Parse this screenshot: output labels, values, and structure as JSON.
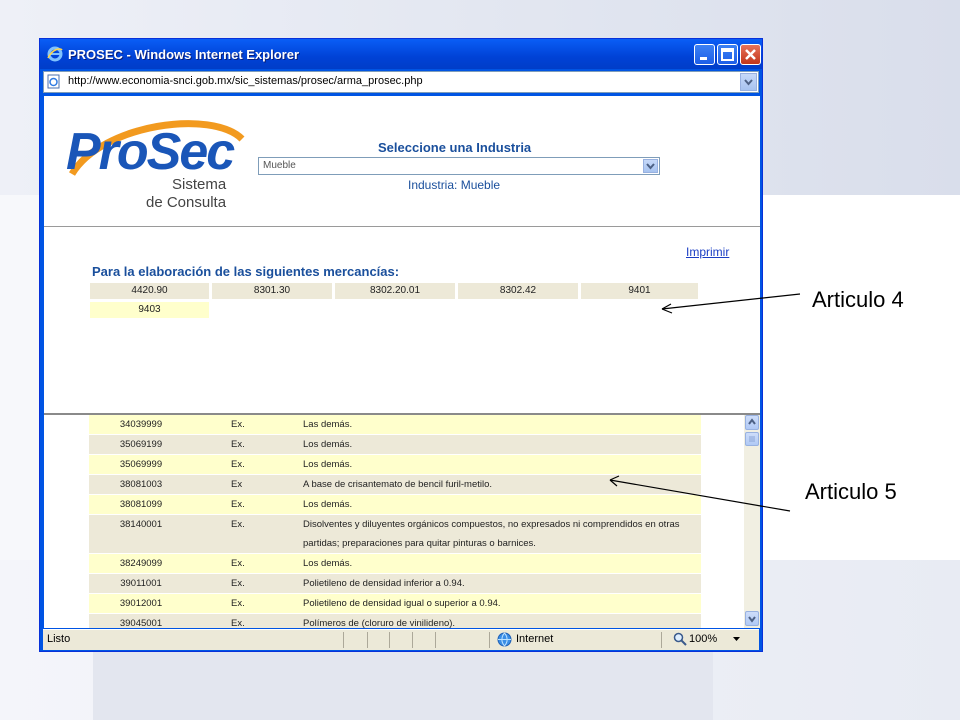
{
  "window": {
    "title": "PROSEC - Windows Internet Explorer"
  },
  "address": {
    "url": "http://www.economia-snci.gob.mx/sic_sistemas/prosec/arma_prosec.php"
  },
  "logo": {
    "name": "ProSec",
    "line1": "Sistema",
    "line2": "de Consulta"
  },
  "header": {
    "select_title": "Seleccione una Industria",
    "select_value": "Mueble",
    "industry_label": "Industria: Mueble"
  },
  "print_link": "Imprimir",
  "merchandise": {
    "title": "Para la elaboración de las siguientes mercancías:",
    "codes": [
      "4420.90",
      "8301.30",
      "8302.20.01",
      "8302.42",
      "9401",
      "9403"
    ]
  },
  "table": {
    "rows": [
      {
        "code": "34039999",
        "ex": "Ex.",
        "desc": "Las demás."
      },
      {
        "code": "35069199",
        "ex": "Ex.",
        "desc": "Los demás."
      },
      {
        "code": "35069999",
        "ex": "Ex.",
        "desc": "Los demás."
      },
      {
        "code": "38081003",
        "ex": "Ex",
        "desc": "A base de crisantemato de bencil furil-metilo."
      },
      {
        "code": "38081099",
        "ex": "Ex.",
        "desc": "Los demás."
      },
      {
        "code": "38140001",
        "ex": "Ex.",
        "desc": "Disolventes y diluyentes orgánicos compuestos, no expresados ni comprendidos en otras partidas; preparaciones para quitar pinturas o barnices."
      },
      {
        "code": "38249099",
        "ex": "Ex.",
        "desc": "Los demás."
      },
      {
        "code": "39011001",
        "ex": "Ex.",
        "desc": "Polietileno de densidad inferior a 0.94."
      },
      {
        "code": "39012001",
        "ex": "Ex.",
        "desc": "Polietileno de densidad igual o superior a 0.94."
      },
      {
        "code": "39045001",
        "ex": "Ex.",
        "desc": "Polímeros de (cloruro de vinilideno)."
      }
    ]
  },
  "status": {
    "left": "Listo",
    "zone": "Internet",
    "zoom": "100%"
  },
  "annotations": {
    "a4": "Articulo  4",
    "a5": "Articulo  5"
  },
  "colors": {
    "titlebar": "#0054e3",
    "row_light": "#ffffcc",
    "row_dark": "#ede9d8",
    "heading_blue": "#1a4f9c"
  }
}
